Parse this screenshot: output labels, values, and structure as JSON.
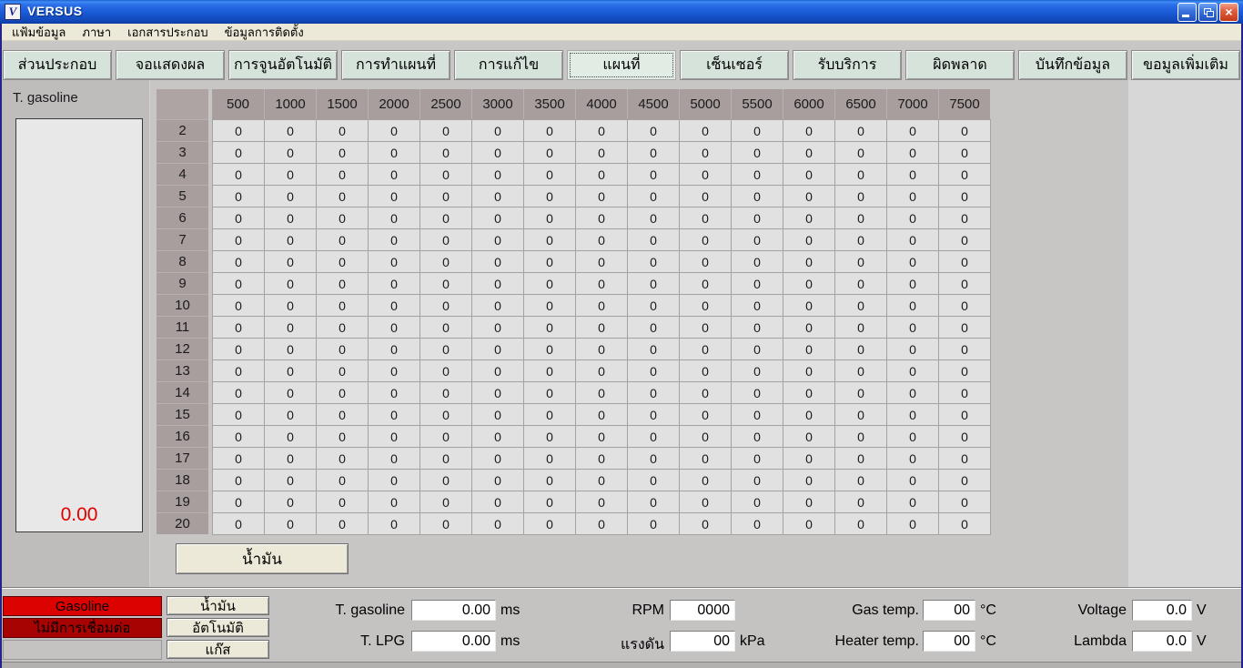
{
  "window": {
    "title": "VERSUS",
    "icon_letter": "V"
  },
  "window_controls": {
    "minimize": "minimize",
    "restore": "restore",
    "close": "×"
  },
  "menu": {
    "items": [
      "แฟ้มข้อมูล",
      "ภาษา",
      "เอกสารประกอบ",
      "ข้อมูลการติดตั้ง"
    ]
  },
  "tabs": [
    {
      "label": "ส่วนประกอบ",
      "selected": false
    },
    {
      "label": "จอแสดงผล",
      "selected": false
    },
    {
      "label": "การจูนอัตโนมัติ",
      "selected": false
    },
    {
      "label": "การทำแผนที่",
      "selected": false
    },
    {
      "label": "การแก้ไข",
      "selected": false
    },
    {
      "label": "แผนที่",
      "selected": true
    },
    {
      "label": "เซ็นเซอร์",
      "selected": false
    },
    {
      "label": "รับบริการ",
      "selected": false
    },
    {
      "label": "ผิดพลาด",
      "selected": false
    },
    {
      "label": "บันทึกข้อมูล",
      "selected": false
    },
    {
      "label": "ขอมูลเพิ่มเติม",
      "selected": false
    }
  ],
  "gauge": {
    "label": "T. gasoline",
    "value": "0.00",
    "value_color": "#dd0000"
  },
  "map_table": {
    "col_headers": [
      "500",
      "1000",
      "1500",
      "2000",
      "2500",
      "3000",
      "3500",
      "4000",
      "4500",
      "5000",
      "5500",
      "6000",
      "6500",
      "7000",
      "7500"
    ],
    "row_headers": [
      "2",
      "3",
      "4",
      "5",
      "6",
      "7",
      "8",
      "9",
      "10",
      "11",
      "12",
      "13",
      "14",
      "15",
      "16",
      "17",
      "18",
      "19",
      "20"
    ],
    "values": [
      [
        0,
        0,
        0,
        0,
        0,
        0,
        0,
        0,
        0,
        0,
        0,
        0,
        0,
        0,
        0
      ],
      [
        0,
        0,
        0,
        0,
        0,
        0,
        0,
        0,
        0,
        0,
        0,
        0,
        0,
        0,
        0
      ],
      [
        0,
        0,
        0,
        0,
        0,
        0,
        0,
        0,
        0,
        0,
        0,
        0,
        0,
        0,
        0
      ],
      [
        0,
        0,
        0,
        0,
        0,
        0,
        0,
        0,
        0,
        0,
        0,
        0,
        0,
        0,
        0
      ],
      [
        0,
        0,
        0,
        0,
        0,
        0,
        0,
        0,
        0,
        0,
        0,
        0,
        0,
        0,
        0
      ],
      [
        0,
        0,
        0,
        0,
        0,
        0,
        0,
        0,
        0,
        0,
        0,
        0,
        0,
        0,
        0
      ],
      [
        0,
        0,
        0,
        0,
        0,
        0,
        0,
        0,
        0,
        0,
        0,
        0,
        0,
        0,
        0
      ],
      [
        0,
        0,
        0,
        0,
        0,
        0,
        0,
        0,
        0,
        0,
        0,
        0,
        0,
        0,
        0
      ],
      [
        0,
        0,
        0,
        0,
        0,
        0,
        0,
        0,
        0,
        0,
        0,
        0,
        0,
        0,
        0
      ],
      [
        0,
        0,
        0,
        0,
        0,
        0,
        0,
        0,
        0,
        0,
        0,
        0,
        0,
        0,
        0
      ],
      [
        0,
        0,
        0,
        0,
        0,
        0,
        0,
        0,
        0,
        0,
        0,
        0,
        0,
        0,
        0
      ],
      [
        0,
        0,
        0,
        0,
        0,
        0,
        0,
        0,
        0,
        0,
        0,
        0,
        0,
        0,
        0
      ],
      [
        0,
        0,
        0,
        0,
        0,
        0,
        0,
        0,
        0,
        0,
        0,
        0,
        0,
        0,
        0
      ],
      [
        0,
        0,
        0,
        0,
        0,
        0,
        0,
        0,
        0,
        0,
        0,
        0,
        0,
        0,
        0
      ],
      [
        0,
        0,
        0,
        0,
        0,
        0,
        0,
        0,
        0,
        0,
        0,
        0,
        0,
        0,
        0
      ],
      [
        0,
        0,
        0,
        0,
        0,
        0,
        0,
        0,
        0,
        0,
        0,
        0,
        0,
        0,
        0
      ],
      [
        0,
        0,
        0,
        0,
        0,
        0,
        0,
        0,
        0,
        0,
        0,
        0,
        0,
        0,
        0
      ],
      [
        0,
        0,
        0,
        0,
        0,
        0,
        0,
        0,
        0,
        0,
        0,
        0,
        0,
        0,
        0
      ],
      [
        0,
        0,
        0,
        0,
        0,
        0,
        0,
        0,
        0,
        0,
        0,
        0,
        0,
        0,
        0
      ]
    ]
  },
  "fuel_button": {
    "label": "น้ำมัน"
  },
  "status": {
    "fuel_mode": "Gasoline",
    "connection": "ไม่มีการเชื่อมต่อ",
    "mode_buttons": [
      "น้ำมัน",
      "อัตโนมัติ",
      "แก๊ส"
    ],
    "fields": {
      "t_gasoline": {
        "label": "T. gasoline",
        "value": "0.00",
        "unit": "ms"
      },
      "t_lpg": {
        "label": "T. LPG",
        "value": "0.00",
        "unit": "ms"
      },
      "rpm": {
        "label": "RPM",
        "value": "0000",
        "unit": ""
      },
      "pressure": {
        "label": "แรงดัน",
        "value": "00",
        "unit": "kPa"
      },
      "gas_temp": {
        "label": "Gas temp.",
        "value": "00",
        "unit": "°C"
      },
      "heater_temp": {
        "label": "Heater temp.",
        "value": "00",
        "unit": "°C"
      },
      "voltage": {
        "label": "Voltage",
        "value": "0.0",
        "unit": "V"
      },
      "lambda": {
        "label": "Lambda",
        "value": "0.0",
        "unit": "V"
      }
    }
  },
  "colors": {
    "titlebar_blue": "#2a6ee8",
    "tab_green": "#d5e3da",
    "table_header_taupe": "#a89e9e",
    "cell_gray": "#e2e1e1",
    "alert_red": "#dd0202",
    "alert_dark_red": "#a80303",
    "button_cream": "#ece9d8",
    "gauge_value_red": "#dd0000"
  }
}
